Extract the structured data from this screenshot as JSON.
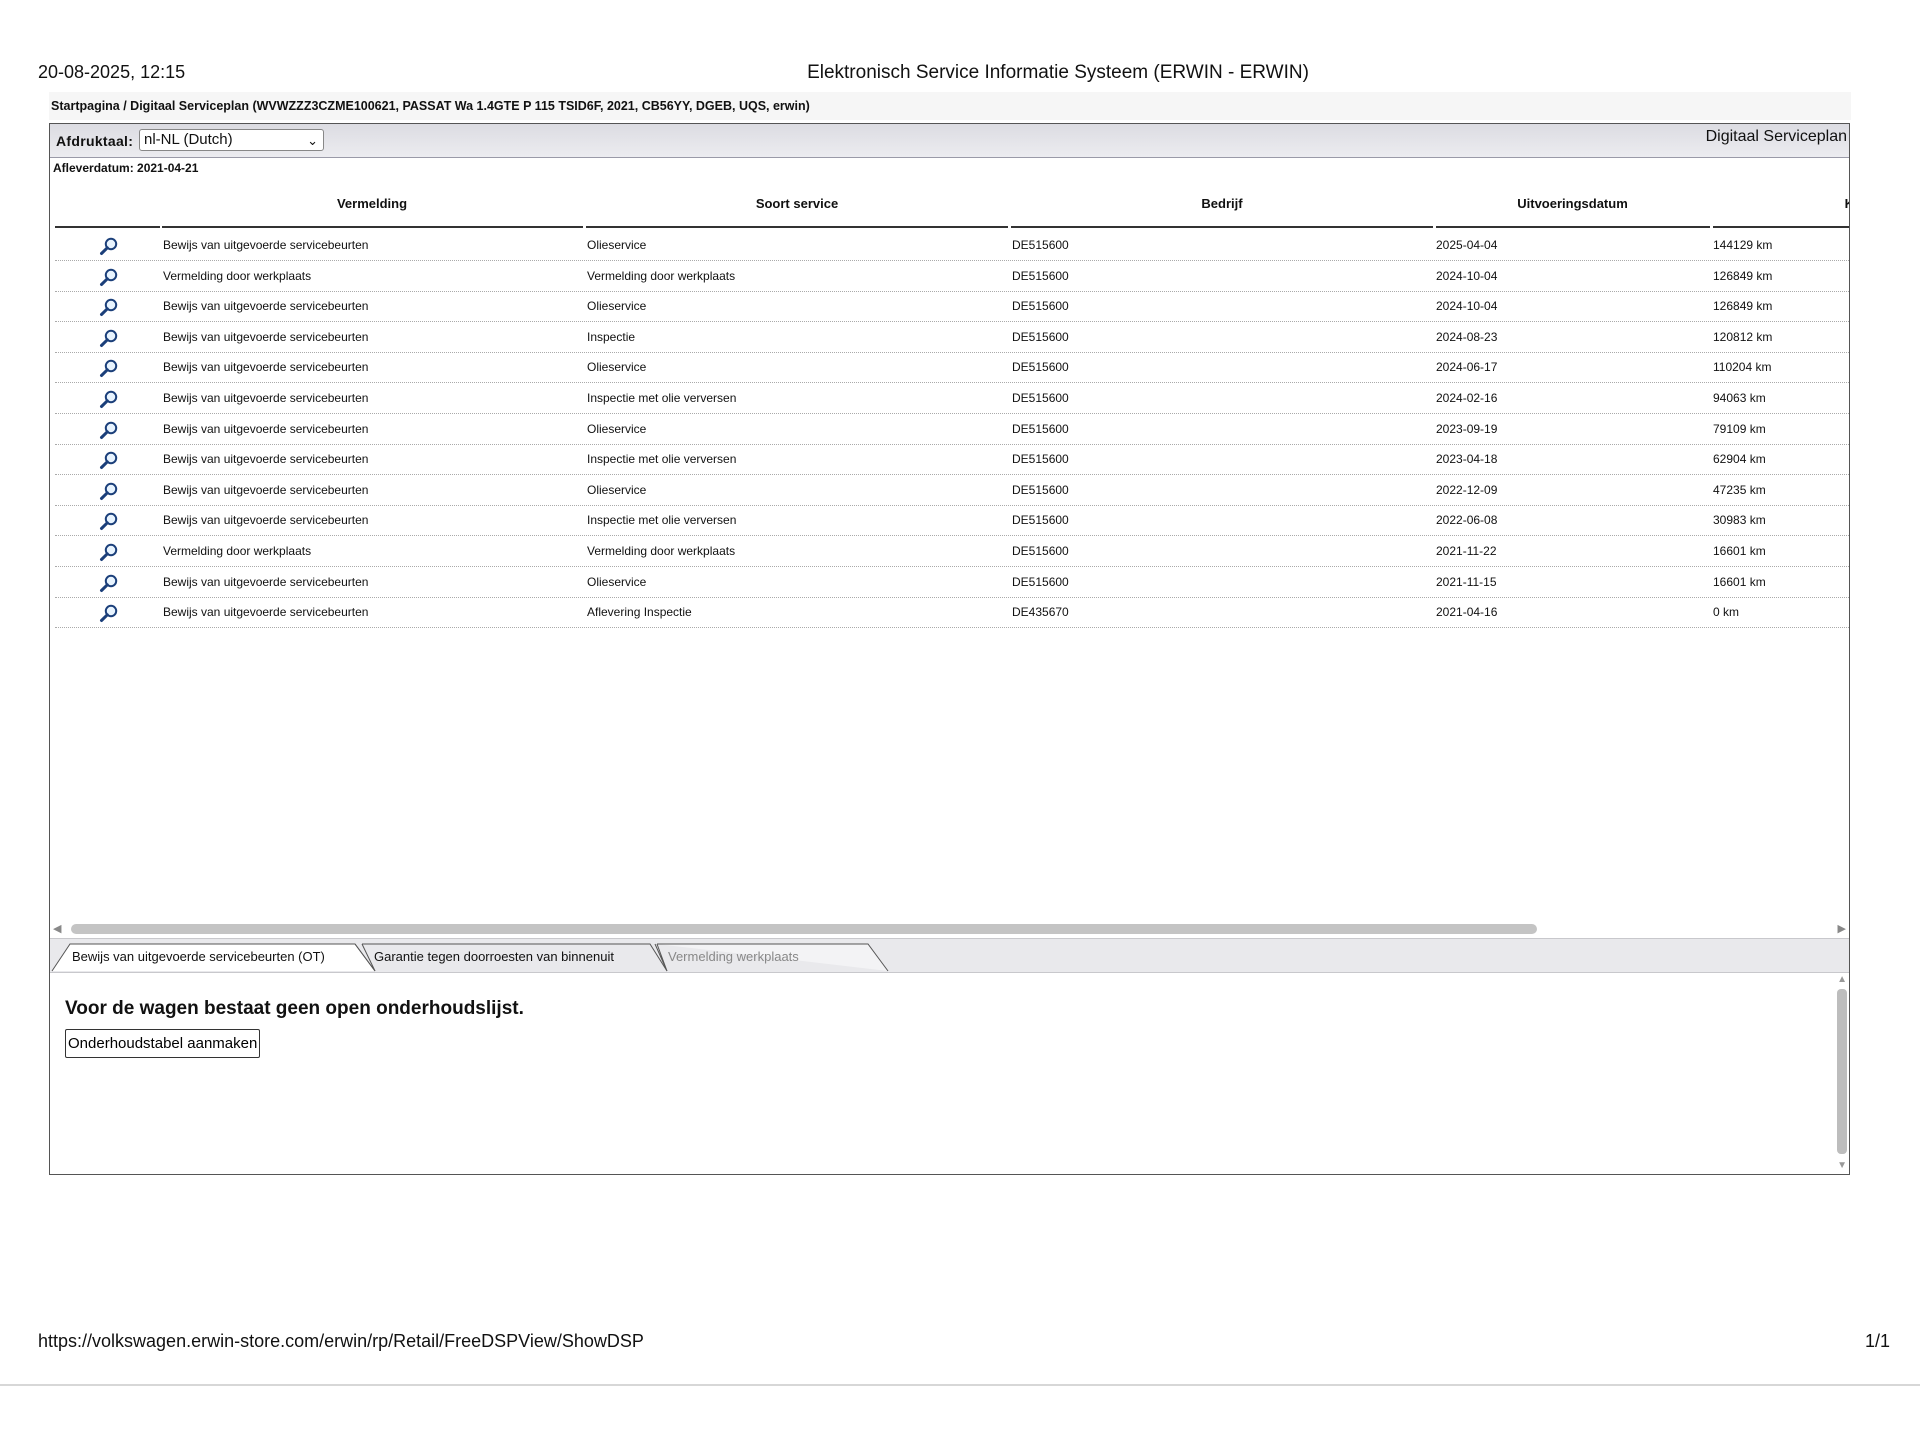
{
  "print_header": {
    "datetime": "20-08-2025, 12:15",
    "title": "Elektronisch Service Informatie Systeem (ERWIN - ERWIN)"
  },
  "breadcrumb": "Startpagina / Digitaal Serviceplan (WVWZZZ3CZME100621, PASSAT Wa 1.4GTE P 115 TSID6F, 2021, CB56YY, DGEB, UQS, erwin)",
  "toolbar": {
    "language_label": "Afdruktaal:",
    "language_value": "nl-NL (Dutch)",
    "page_heading": "Digitaal Serviceplan"
  },
  "delivery_date": "Afleverdatum: 2021-04-21",
  "table": {
    "columns": [
      "Vermelding",
      "Soort service",
      "Bedrijf",
      "Uitvoeringsdatum",
      "Kilometerstand"
    ],
    "rows": [
      {
        "vermelding": "Bewijs van uitgevoerde servicebeurten",
        "soort": "Olieservice",
        "bedrijf": "DE515600",
        "datum": "2025-04-04",
        "km": "144129 km"
      },
      {
        "vermelding": "Vermelding door werkplaats",
        "soort": "Vermelding door werkplaats",
        "bedrijf": "DE515600",
        "datum": "2024-10-04",
        "km": "126849 km"
      },
      {
        "vermelding": "Bewijs van uitgevoerde servicebeurten",
        "soort": "Olieservice",
        "bedrijf": "DE515600",
        "datum": "2024-10-04",
        "km": "126849 km"
      },
      {
        "vermelding": "Bewijs van uitgevoerde servicebeurten",
        "soort": "Inspectie",
        "bedrijf": "DE515600",
        "datum": "2024-08-23",
        "km": "120812 km"
      },
      {
        "vermelding": "Bewijs van uitgevoerde servicebeurten",
        "soort": "Olieservice",
        "bedrijf": "DE515600",
        "datum": "2024-06-17",
        "km": "110204 km"
      },
      {
        "vermelding": "Bewijs van uitgevoerde servicebeurten",
        "soort": "Inspectie met olie verversen",
        "bedrijf": "DE515600",
        "datum": "2024-02-16",
        "km": "94063 km"
      },
      {
        "vermelding": "Bewijs van uitgevoerde servicebeurten",
        "soort": "Olieservice",
        "bedrijf": "DE515600",
        "datum": "2023-09-19",
        "km": "79109 km"
      },
      {
        "vermelding": "Bewijs van uitgevoerde servicebeurten",
        "soort": "Inspectie met olie verversen",
        "bedrijf": "DE515600",
        "datum": "2023-04-18",
        "km": "62904 km"
      },
      {
        "vermelding": "Bewijs van uitgevoerde servicebeurten",
        "soort": "Olieservice",
        "bedrijf": "DE515600",
        "datum": "2022-12-09",
        "km": "47235 km"
      },
      {
        "vermelding": "Bewijs van uitgevoerde servicebeurten",
        "soort": "Inspectie met olie verversen",
        "bedrijf": "DE515600",
        "datum": "2022-06-08",
        "km": "30983 km"
      },
      {
        "vermelding": "Vermelding door werkplaats",
        "soort": "Vermelding door werkplaats",
        "bedrijf": "DE515600",
        "datum": "2021-11-22",
        "km": "16601 km"
      },
      {
        "vermelding": "Bewijs van uitgevoerde servicebeurten",
        "soort": "Olieservice",
        "bedrijf": "DE515600",
        "datum": "2021-11-15",
        "km": "16601 km"
      },
      {
        "vermelding": "Bewijs van uitgevoerde servicebeurten",
        "soort": "Aflevering Inspectie",
        "bedrijf": "DE435670",
        "datum": "2021-04-16",
        "km": "0 km"
      }
    ]
  },
  "tabs": [
    {
      "label": "Bewijs van uitgevoerde servicebeurten (OT)",
      "state": "active"
    },
    {
      "label": "Garantie tegen doorroesten van binnenuit",
      "state": "normal"
    },
    {
      "label": "Vermelding werkplaats",
      "state": "disabled"
    }
  ],
  "maintenance": {
    "message": "Voor de wagen bestaat geen open onderhoudslijst.",
    "button_label": "Onderhoudstabel aanmaken"
  },
  "print_footer": {
    "url": "https://volkswagen.erwin-store.com/erwin/rp/Retail/FreeDSPView/ShowDSP",
    "page": "1/1"
  },
  "icons": {
    "row_detail": "magnifier-icon",
    "select_arrow": "chevron-down-icon"
  }
}
